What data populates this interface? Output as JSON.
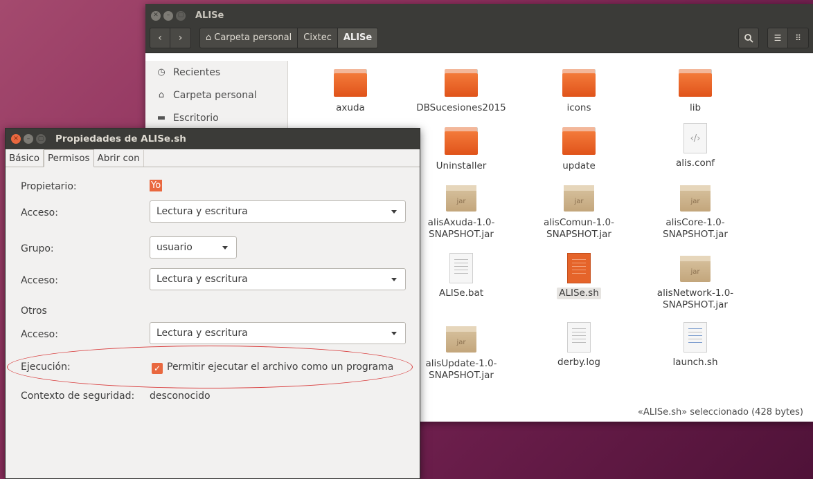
{
  "file_manager": {
    "title": "ALISe",
    "breadcrumbs": [
      "Carpeta personal",
      "Cixtec",
      "ALISe"
    ],
    "sidebar": [
      {
        "label": "Recientes",
        "icon": "clock-icon"
      },
      {
        "label": "Carpeta personal",
        "icon": "home-icon"
      },
      {
        "label": "Escritorio",
        "icon": "folder-icon"
      }
    ],
    "files": [
      {
        "name": "axuda",
        "kind": "folder"
      },
      {
        "name": "DBSucesiones2015",
        "kind": "folder"
      },
      {
        "name": "icons",
        "kind": "folder"
      },
      {
        "name": "lib",
        "kind": "folder"
      },
      {
        "name": "Uninstaller",
        "kind": "folder"
      },
      {
        "name": "update",
        "kind": "folder"
      },
      {
        "name": "alis.conf",
        "kind": "config"
      },
      {
        "name": "alisAxuda-1.0-SNAPSHOT.jar",
        "kind": "jar"
      },
      {
        "name": "alisComun-1.0-SNAPSHOT.jar",
        "kind": "jar"
      },
      {
        "name": "alisCore-1.0-SNAPSHOT.jar",
        "kind": "jar"
      },
      {
        "name": "ALISe.bat",
        "kind": "text"
      },
      {
        "name": "ALISe.sh",
        "kind": "script"
      },
      {
        "name": "alisNetwork-1.0-SNAPSHOT.jar",
        "kind": "jar"
      },
      {
        "name": "alisUpdate-1.0-SNAPSHOT.jar",
        "kind": "jar"
      },
      {
        "name": "derby.log",
        "kind": "text"
      },
      {
        "name": "launch.sh",
        "kind": "script-text"
      }
    ],
    "status": "«ALISe.sh» seleccionado (428 bytes)"
  },
  "dialog": {
    "title": "Propiedades de ALISe.sh",
    "tabs": [
      "Básico",
      "Permisos",
      "Abrir con"
    ],
    "owner_label": "Propietario:",
    "owner_value": "Yo",
    "access_label": "Acceso:",
    "owner_access": "Lectura y escritura",
    "group_label": "Grupo:",
    "group_value": "usuario",
    "group_access": "Lectura y escritura",
    "others_label": "Otros",
    "others_access": "Lectura y escritura",
    "exec_label": "Ejecución:",
    "exec_checkbox": "Permitir ejecutar el archivo como un programa",
    "exec_checked": true,
    "security_label": "Contexto de seguridad:",
    "security_value": "desconocido"
  },
  "colors": {
    "accent": "#e9683f",
    "titlebar": "#3b3b38",
    "highlight_ellipse": "#d83a3a"
  }
}
